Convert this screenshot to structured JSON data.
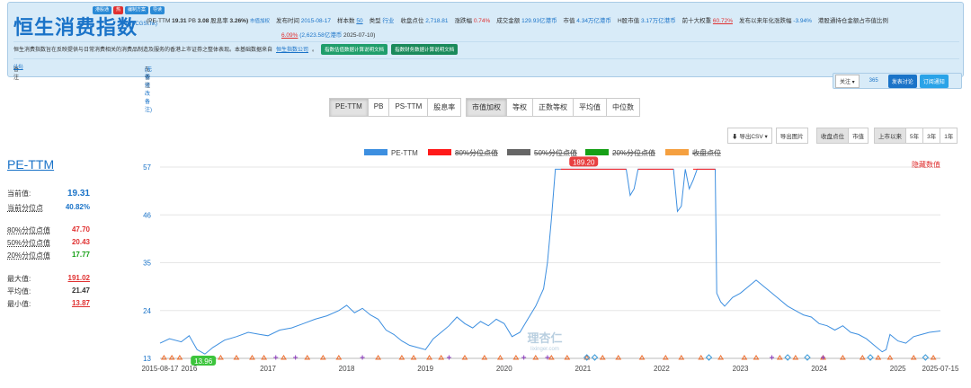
{
  "header": {
    "title": "恒生消费指数",
    "code": "(HSCGSI.hk)",
    "badges": [
      {
        "label": "港股通",
        "color": "#2a8ad6"
      },
      {
        "label": "热",
        "color": "#e03030"
      },
      {
        "label": "编制方案",
        "color": "#2a8ad6"
      },
      {
        "label": "导读",
        "color": "#2a8ad6"
      }
    ],
    "pe_ttm_label": "(PE-TTM",
    "pe_ttm_value": "19.31",
    "pb_label": "PB",
    "pb_value": "3.08",
    "dividend_label": "股息率",
    "dividend_value": "3.26%)",
    "weighting": "市值加权",
    "release_label": "发布时间",
    "release_value": "2015-08-17",
    "sample_label": "样本数",
    "sample_value": "50",
    "type_label": "类型",
    "type_value": "行业",
    "close_label": "收盘点位",
    "close_value": "2,718.81",
    "change_label": "涨跌幅",
    "change_value": "0.74%",
    "turnover_label": "成交金额",
    "turnover_value": "129.93亿港币",
    "mcap_label": "市值",
    "mcap_value": "4.34万亿港币",
    "hmcap_label": "H股市值",
    "hmcap_value": "3.17万亿港币",
    "top10_label": "前十大权重",
    "top10_value": "60.72%",
    "since_label": "发布以来年化涨跌幅",
    "since_value": "-3.94%",
    "southbound_label": "港股通持仓金额占市值比例",
    "southbound_pct": "6.09%",
    "southbound_amount": "(2,623.58亿港币",
    "southbound_date": "2025-07-10)"
  },
  "description": {
    "text": "恒生消费指数旨在反映提供与日常消费相关的消费品制造及服务的香港上市证券之整体表现。本基础数据来自",
    "link": "恒生指数公司",
    "end": "。",
    "btn1": "指数估值数据计算说明文档",
    "btn2": "指数财务数据计算说明文档"
  },
  "notes": {
    "note_label": "备注",
    "note_count": "(16)",
    "no_note_label": "无备注",
    "no_note_link": "(无需修改备注)"
  },
  "follow": {
    "label": "关注 ▾",
    "count": "365",
    "discuss": "发表讨论",
    "subscribe": "订阅通知"
  },
  "metric_tabs": [
    "PE-TTM",
    "PB",
    "PS-TTM",
    "股息率"
  ],
  "weight_tabs": [
    "市值加权",
    "等权",
    "正数等权",
    "平均值",
    "中位数"
  ],
  "tools": {
    "export_csv": "导出CSV ▾",
    "export_img": "导出图片",
    "mode": [
      "收盘点位",
      "市值"
    ],
    "periods": [
      "上市以来",
      "5年",
      "3年",
      "1年"
    ]
  },
  "left_stats": {
    "title": "PE-TTM",
    "current_label": "当前值:",
    "current_value": "19.31",
    "pct_label": "当前分位点",
    "pct_value": "40.82%",
    "p80_label": "80%分位点值",
    "p80_value": "47.70",
    "p50_label": "50%分位点值",
    "p50_value": "20.43",
    "p20_label": "20%分位点值",
    "p20_value": "17.77",
    "max_label": "最大值:",
    "max_value": "191.02",
    "avg_label": "平均值:",
    "avg_value": "21.47",
    "min_label": "最小值:",
    "min_value": "13.87"
  },
  "colors": {
    "pe_line": "#3d8fe0",
    "p80": "#ff1a1a",
    "p50": "#666666",
    "p20": "#16a016",
    "close": "#f5a040"
  },
  "chart_data": {
    "type": "line",
    "legend": [
      "PE-TTM",
      "80%分位点值",
      "50%分位点值",
      "20%分位点值",
      "收盘点位"
    ],
    "hide_label": "隐藏数值",
    "ylim": [
      13,
      57
    ],
    "yticks": [
      13,
      24,
      35,
      46,
      57
    ],
    "xlabels": [
      "2015-08-17",
      "2016",
      "2017",
      "2018",
      "2019",
      "2020",
      "2021",
      "2022",
      "2023",
      "2024",
      "2025",
      "2025-07-15"
    ],
    "max_label": "189.20",
    "min_label": "13.96",
    "watermark": "理杏仁",
    "watermark_sub": "lixinger.com",
    "series": [
      {
        "name": "PE-TTM",
        "x": [
          2015.63,
          2015.75,
          2015.9,
          2016.0,
          2016.1,
          2016.2,
          2016.3,
          2016.45,
          2016.6,
          2016.75,
          2016.9,
          2017.0,
          2017.15,
          2017.3,
          2017.45,
          2017.6,
          2017.75,
          2017.9,
          2018.0,
          2018.1,
          2018.2,
          2018.3,
          2018.4,
          2018.5,
          2018.6,
          2018.7,
          2018.8,
          2018.9,
          2019.0,
          2019.1,
          2019.2,
          2019.3,
          2019.4,
          2019.5,
          2019.6,
          2019.7,
          2019.8,
          2019.9,
          2020.0,
          2020.1,
          2020.2,
          2020.3,
          2020.4,
          2020.5,
          2020.55,
          2020.6,
          2020.65,
          2020.68,
          2020.72,
          2021.0,
          2021.3,
          2021.55,
          2021.6,
          2021.65,
          2021.7,
          2021.8,
          2022.0,
          2022.15,
          2022.2,
          2022.25,
          2022.3,
          2022.35,
          2022.4,
          2022.45,
          2022.55,
          2022.68,
          2022.7,
          2022.75,
          2022.8,
          2022.9,
          2023.0,
          2023.1,
          2023.2,
          2023.3,
          2023.4,
          2023.5,
          2023.6,
          2023.7,
          2023.8,
          2023.9,
          2024.0,
          2024.1,
          2024.2,
          2024.3,
          2024.4,
          2024.5,
          2024.6,
          2024.7,
          2024.8,
          2024.85,
          2024.9,
          2025.0,
          2025.1,
          2025.2,
          2025.3,
          2025.4,
          2025.54
        ],
        "values": [
          16.5,
          17.5,
          16.8,
          18.2,
          15.0,
          14.0,
          15.5,
          17.2,
          18.0,
          19.0,
          18.5,
          18.2,
          19.5,
          20.0,
          21.0,
          22.0,
          22.8,
          24.0,
          25.2,
          23.5,
          24.5,
          23.0,
          22.0,
          19.5,
          18.5,
          17.0,
          16.0,
          15.5,
          15.0,
          17.5,
          19.0,
          20.5,
          22.5,
          21.0,
          20.0,
          21.5,
          20.5,
          22.0,
          21.0,
          18.0,
          19.0,
          22.0,
          25.0,
          29.0,
          35.0,
          45.0,
          56.5,
          56.5,
          56.5,
          56.5,
          56.5,
          56.5,
          50.5,
          52.0,
          56.5,
          56.5,
          56.5,
          56.5,
          46.8,
          48.0,
          56.5,
          52.0,
          54.0,
          56.5,
          56.5,
          56.5,
          28.0,
          26.0,
          25.0,
          27.0,
          28.0,
          29.5,
          31.0,
          29.5,
          28.0,
          26.5,
          25.0,
          24.0,
          23.0,
          22.5,
          21.0,
          20.5,
          19.5,
          20.5,
          19.0,
          18.5,
          17.5,
          16.0,
          14.5,
          15.0,
          18.5,
          17.0,
          16.5,
          18.0,
          18.5,
          19.0,
          19.31
        ]
      }
    ],
    "x_positions": [
      2015.63,
      2016.0,
      2017.0,
      2018.0,
      2019.0,
      2020.0,
      2021.0,
      2022.0,
      2023.0,
      2024.0,
      2025.0,
      2025.54
    ]
  }
}
